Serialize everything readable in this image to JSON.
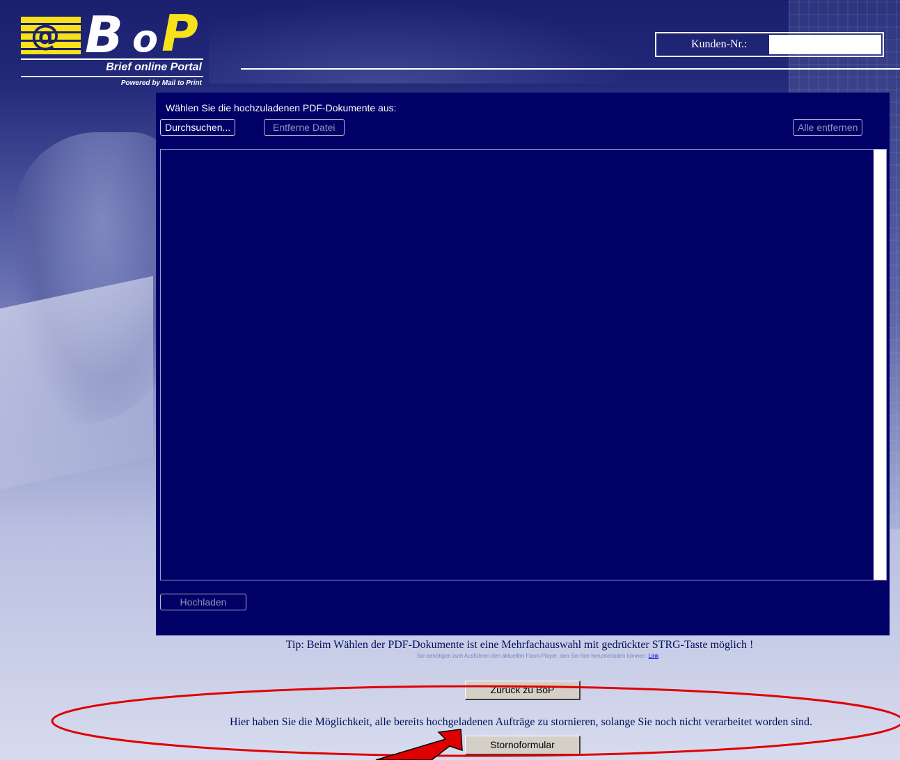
{
  "logo": {
    "badge": "@",
    "b": "B",
    "o": "o",
    "p": "P",
    "tagline": "Brief online Portal",
    "powered": "Powered by Mail to Print"
  },
  "header": {
    "customer_label": "Kunden-Nr.:",
    "customer_value": ""
  },
  "panel": {
    "instruction": "Wählen Sie die hochzuladenen PDF-Dokumente aus:",
    "browse_label": "Durchsuchen...",
    "remove_label": "Entferne Datei",
    "remove_all_label": "Alle entfernen",
    "upload_label": "Hochladen"
  },
  "tip": "Tip: Beim Wählen der PDF-Dokumente ist eine Mehrfachauswahl mit gedrückter STRG-Taste möglich !",
  "flash_note": {
    "text": "Sie benötigen zum Ausführen den aktuellen Flash-Player, den Sie hier herunterladen können:",
    "link": "Link"
  },
  "back_button": "Zurück zu BoP",
  "storno_text": "Hier haben Sie die Möglichkeit, alle bereits hochgeladenen Aufträge zu stornieren, solange Sie noch nicht verarbeitet worden sind.",
  "storno_button": "Stornoformular",
  "colors": {
    "panel": "#000066",
    "brand_yellow": "#f7e21a",
    "annotation_red": "#e00000"
  }
}
